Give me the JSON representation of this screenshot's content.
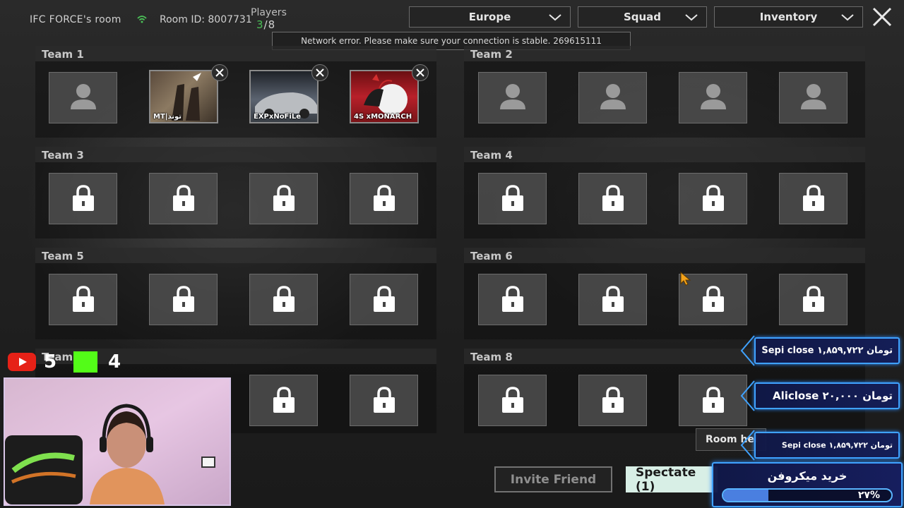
{
  "header": {
    "room_name": "IFC FORCE's room",
    "room_id": "Room ID: 8007731",
    "players_label": "Players",
    "players_current": "3",
    "players_total": "/8"
  },
  "dropdowns": {
    "region": "Europe",
    "mode": "Squad",
    "inventory": "Inventory"
  },
  "toast": "Network error. Please make sure your connection is stable. 269615111",
  "teams": {
    "t1": "Team 1",
    "t2": "Team 2",
    "t3": "Team 3",
    "t4": "Team 4",
    "t5": "Team 5",
    "t6": "Team 6",
    "t7": "Team",
    "t8": "Team 8"
  },
  "players": {
    "p1": "MT|توند",
    "p2": "EXPxNoFiLe",
    "p3": "4S xMONARCH"
  },
  "social": {
    "youtube_count": "5",
    "kick_count": "4"
  },
  "buttons": {
    "room_help": "Room hel",
    "invite": "Invite Friend",
    "spectate": "Spectate (1)"
  },
  "donations": [
    "Sepi close ۱,۸۵۹,۷۲۲ تومان",
    "Aliclose ۲۰,۰۰۰ تومان",
    "Sepi close ۱,۸۵۹,۷۲۲ تومان"
  ],
  "goal": {
    "title": "خرید میکروفن",
    "percent_label": "۲۷%",
    "progress": 0.27
  },
  "colors": {
    "players_accent": "#4bbf57",
    "spectate_bg": "#d8efe6",
    "donation_border": "#3fa2ff"
  }
}
